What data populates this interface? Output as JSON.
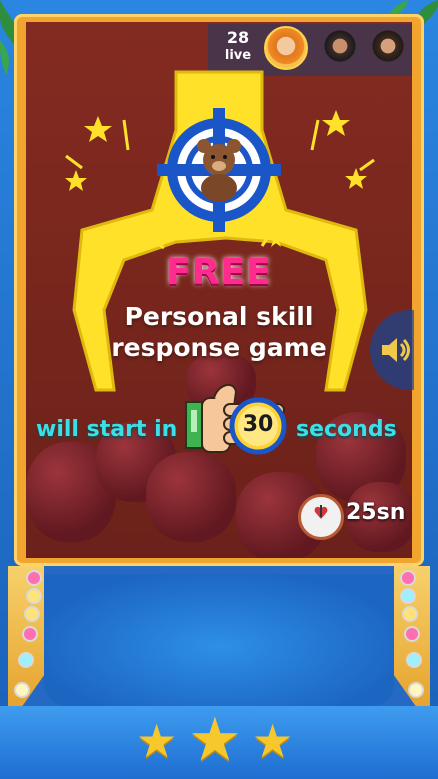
{
  "live": {
    "count": "28",
    "label": "live"
  },
  "promo": {
    "headline": "FREE",
    "subtitle_line1": "Personal skill",
    "subtitle_line2": "response game",
    "start_prefix": "will start in",
    "timer_value": "30",
    "start_suffix": "seconds"
  },
  "countdown": {
    "text": "25sn"
  },
  "viewers": [
    {
      "icon": "viewer-avatar-orange"
    },
    {
      "icon": "viewer-avatar-man"
    },
    {
      "icon": "viewer-avatar-man-2"
    }
  ],
  "rating": {
    "stars": 3
  },
  "colors": {
    "headline": "#ff2c8d",
    "start_text": "#3be0e6",
    "claw": "#ffe12a",
    "target": "#1a56c8",
    "frame": "#f1a52f"
  }
}
